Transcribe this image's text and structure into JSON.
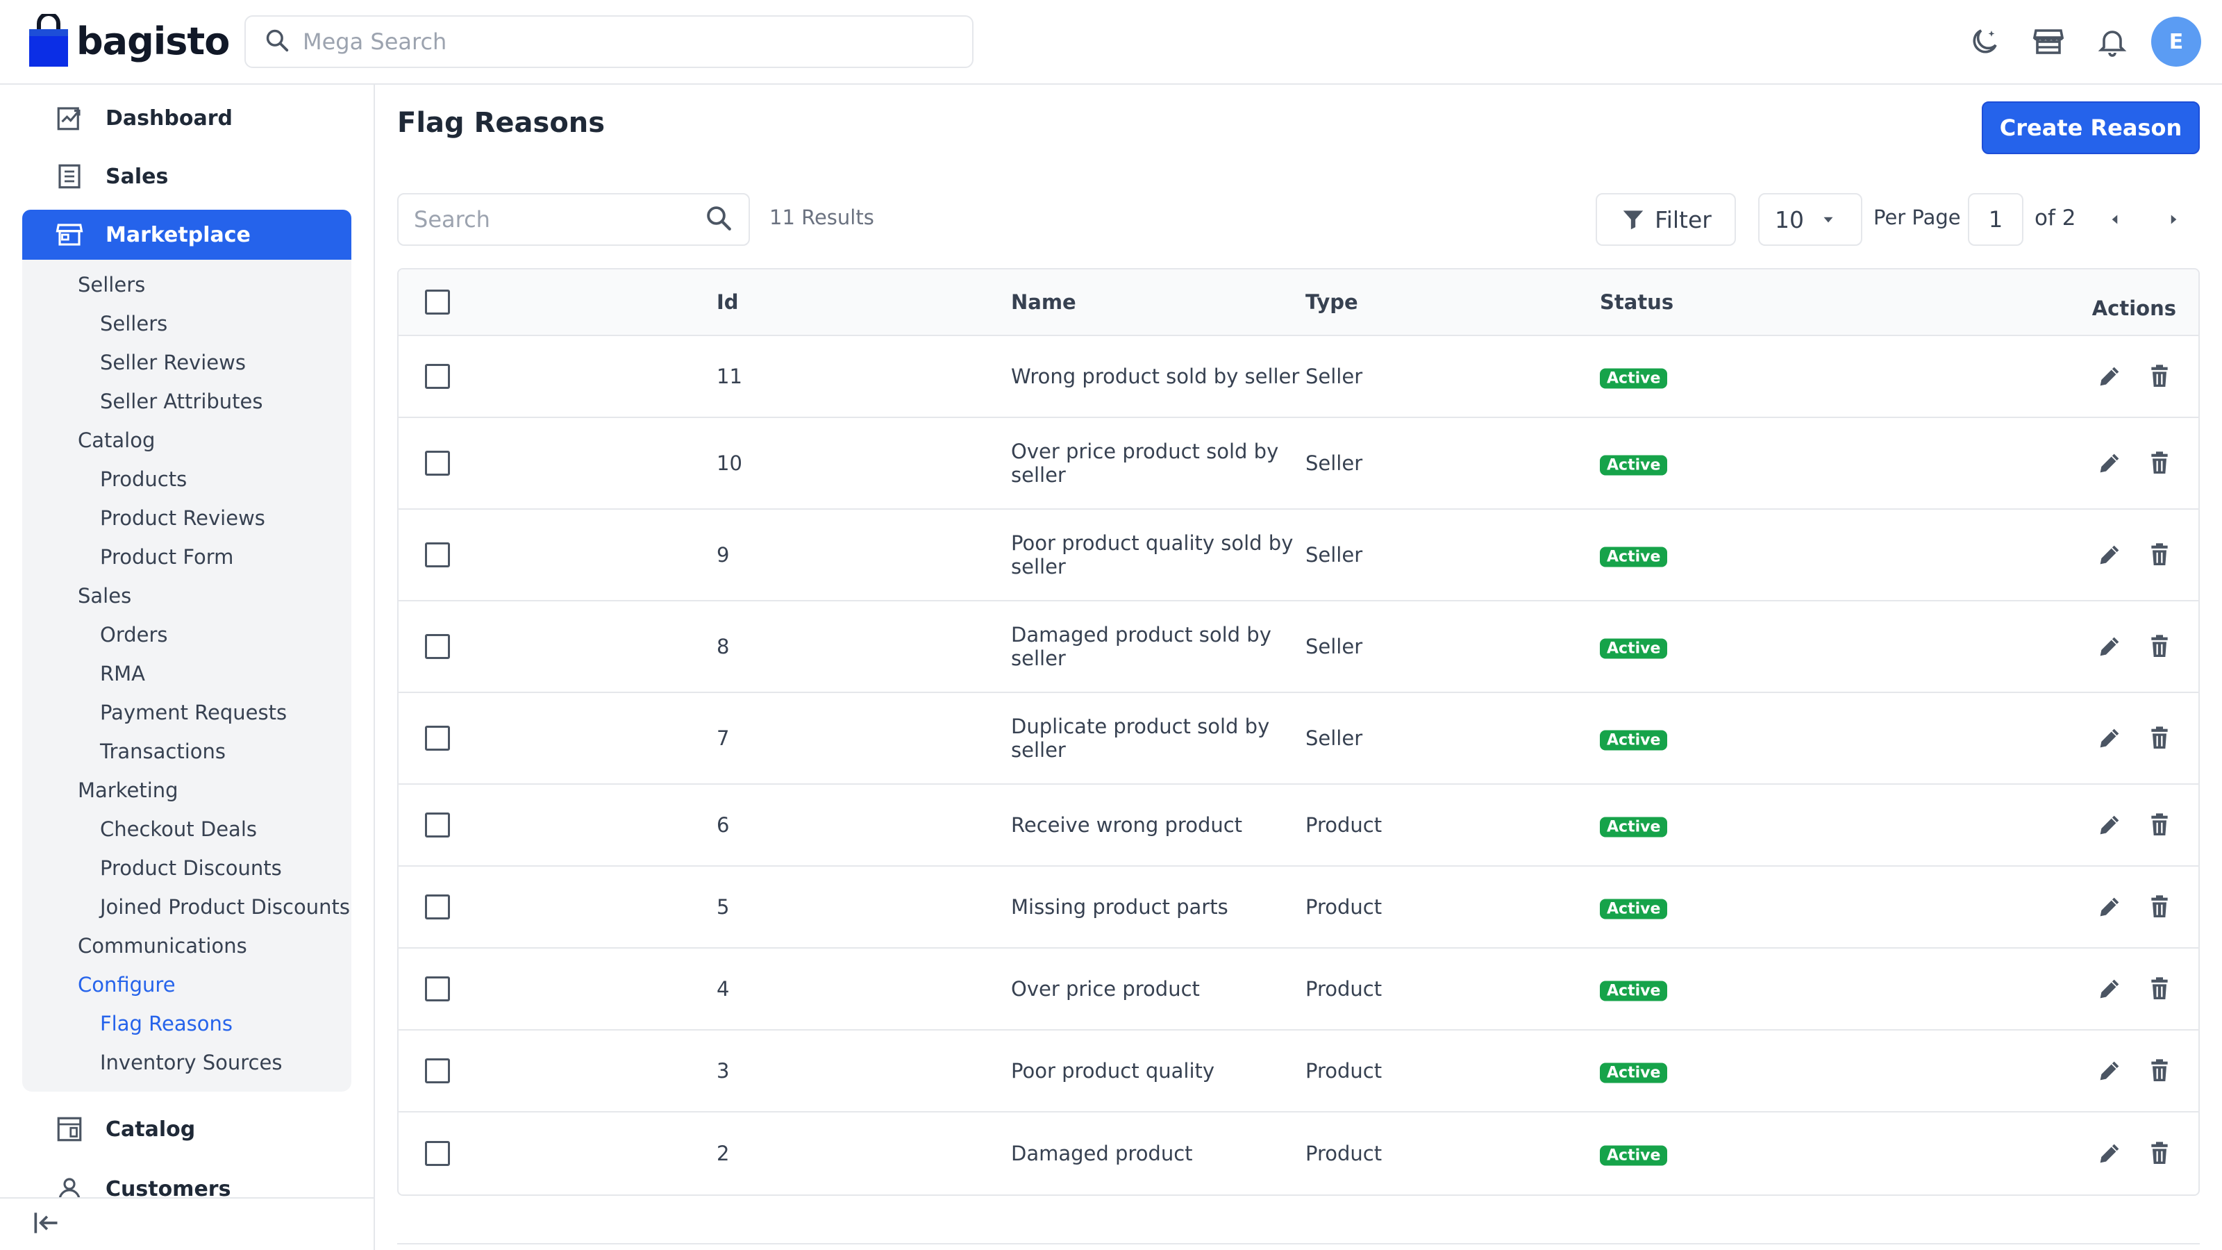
{
  "app": {
    "brand": "bagisto",
    "search_placeholder": "Mega Search",
    "avatar_initial": "E",
    "accent_color": "#2563eb"
  },
  "sidebar": {
    "top_items": [
      {
        "label": "Dashboard",
        "icon": "dashboard-icon"
      },
      {
        "label": "Sales",
        "icon": "sales-icon"
      },
      {
        "label": "Marketplace",
        "icon": "marketplace-icon",
        "active": true
      }
    ],
    "marketplace_sub": [
      {
        "label": "Sellers",
        "level": 1
      },
      {
        "label": "Sellers",
        "level": 2
      },
      {
        "label": "Seller Reviews",
        "level": 2
      },
      {
        "label": "Seller Attributes",
        "level": 2
      },
      {
        "label": "Catalog",
        "level": 1
      },
      {
        "label": "Products",
        "level": 2
      },
      {
        "label": "Product Reviews",
        "level": 2
      },
      {
        "label": "Product Form",
        "level": 2
      },
      {
        "label": "Sales",
        "level": 1
      },
      {
        "label": "Orders",
        "level": 2
      },
      {
        "label": "RMA",
        "level": 2
      },
      {
        "label": "Payment Requests",
        "level": 2
      },
      {
        "label": "Transactions",
        "level": 2
      },
      {
        "label": "Marketing",
        "level": 1
      },
      {
        "label": "Checkout Deals",
        "level": 2
      },
      {
        "label": "Product Discounts",
        "level": 2
      },
      {
        "label": "Joined Product Discounts",
        "level": 2
      },
      {
        "label": "Communications",
        "level": 1
      },
      {
        "label": "Configure",
        "level": 1,
        "active": true
      },
      {
        "label": "Flag Reasons",
        "level": 2,
        "active": true
      },
      {
        "label": "Inventory Sources",
        "level": 2
      }
    ],
    "bottom_items": [
      {
        "label": "Catalog",
        "icon": "catalog-icon"
      },
      {
        "label": "Customers",
        "icon": "customers-icon"
      }
    ]
  },
  "page": {
    "title": "Flag Reasons",
    "create_button": "Create Reason"
  },
  "toolbar": {
    "search_placeholder": "Search",
    "results": "11 Results",
    "filter_label": "Filter",
    "per_page_value": "10",
    "per_page_label": "Per Page",
    "current_page": "1",
    "of_pages": "of 2"
  },
  "table": {
    "columns": {
      "id": "Id",
      "name": "Name",
      "type": "Type",
      "status": "Status",
      "actions": "Actions"
    },
    "rows": [
      {
        "id": "11",
        "name": "Wrong product sold by seller",
        "type": "Seller",
        "status": "Active"
      },
      {
        "id": "10",
        "name": "Over price product sold by seller",
        "type": "Seller",
        "status": "Active"
      },
      {
        "id": "9",
        "name": "Poor product quality sold by seller",
        "type": "Seller",
        "status": "Active"
      },
      {
        "id": "8",
        "name": "Damaged product sold by seller",
        "type": "Seller",
        "status": "Active"
      },
      {
        "id": "7",
        "name": "Duplicate product sold by seller",
        "type": "Seller",
        "status": "Active"
      },
      {
        "id": "6",
        "name": "Receive wrong product",
        "type": "Product",
        "status": "Active"
      },
      {
        "id": "5",
        "name": "Missing product parts",
        "type": "Product",
        "status": "Active"
      },
      {
        "id": "4",
        "name": "Over price product",
        "type": "Product",
        "status": "Active"
      },
      {
        "id": "3",
        "name": "Poor product quality",
        "type": "Product",
        "status": "Active"
      },
      {
        "id": "2",
        "name": "Damaged product",
        "type": "Product",
        "status": "Active"
      }
    ]
  }
}
